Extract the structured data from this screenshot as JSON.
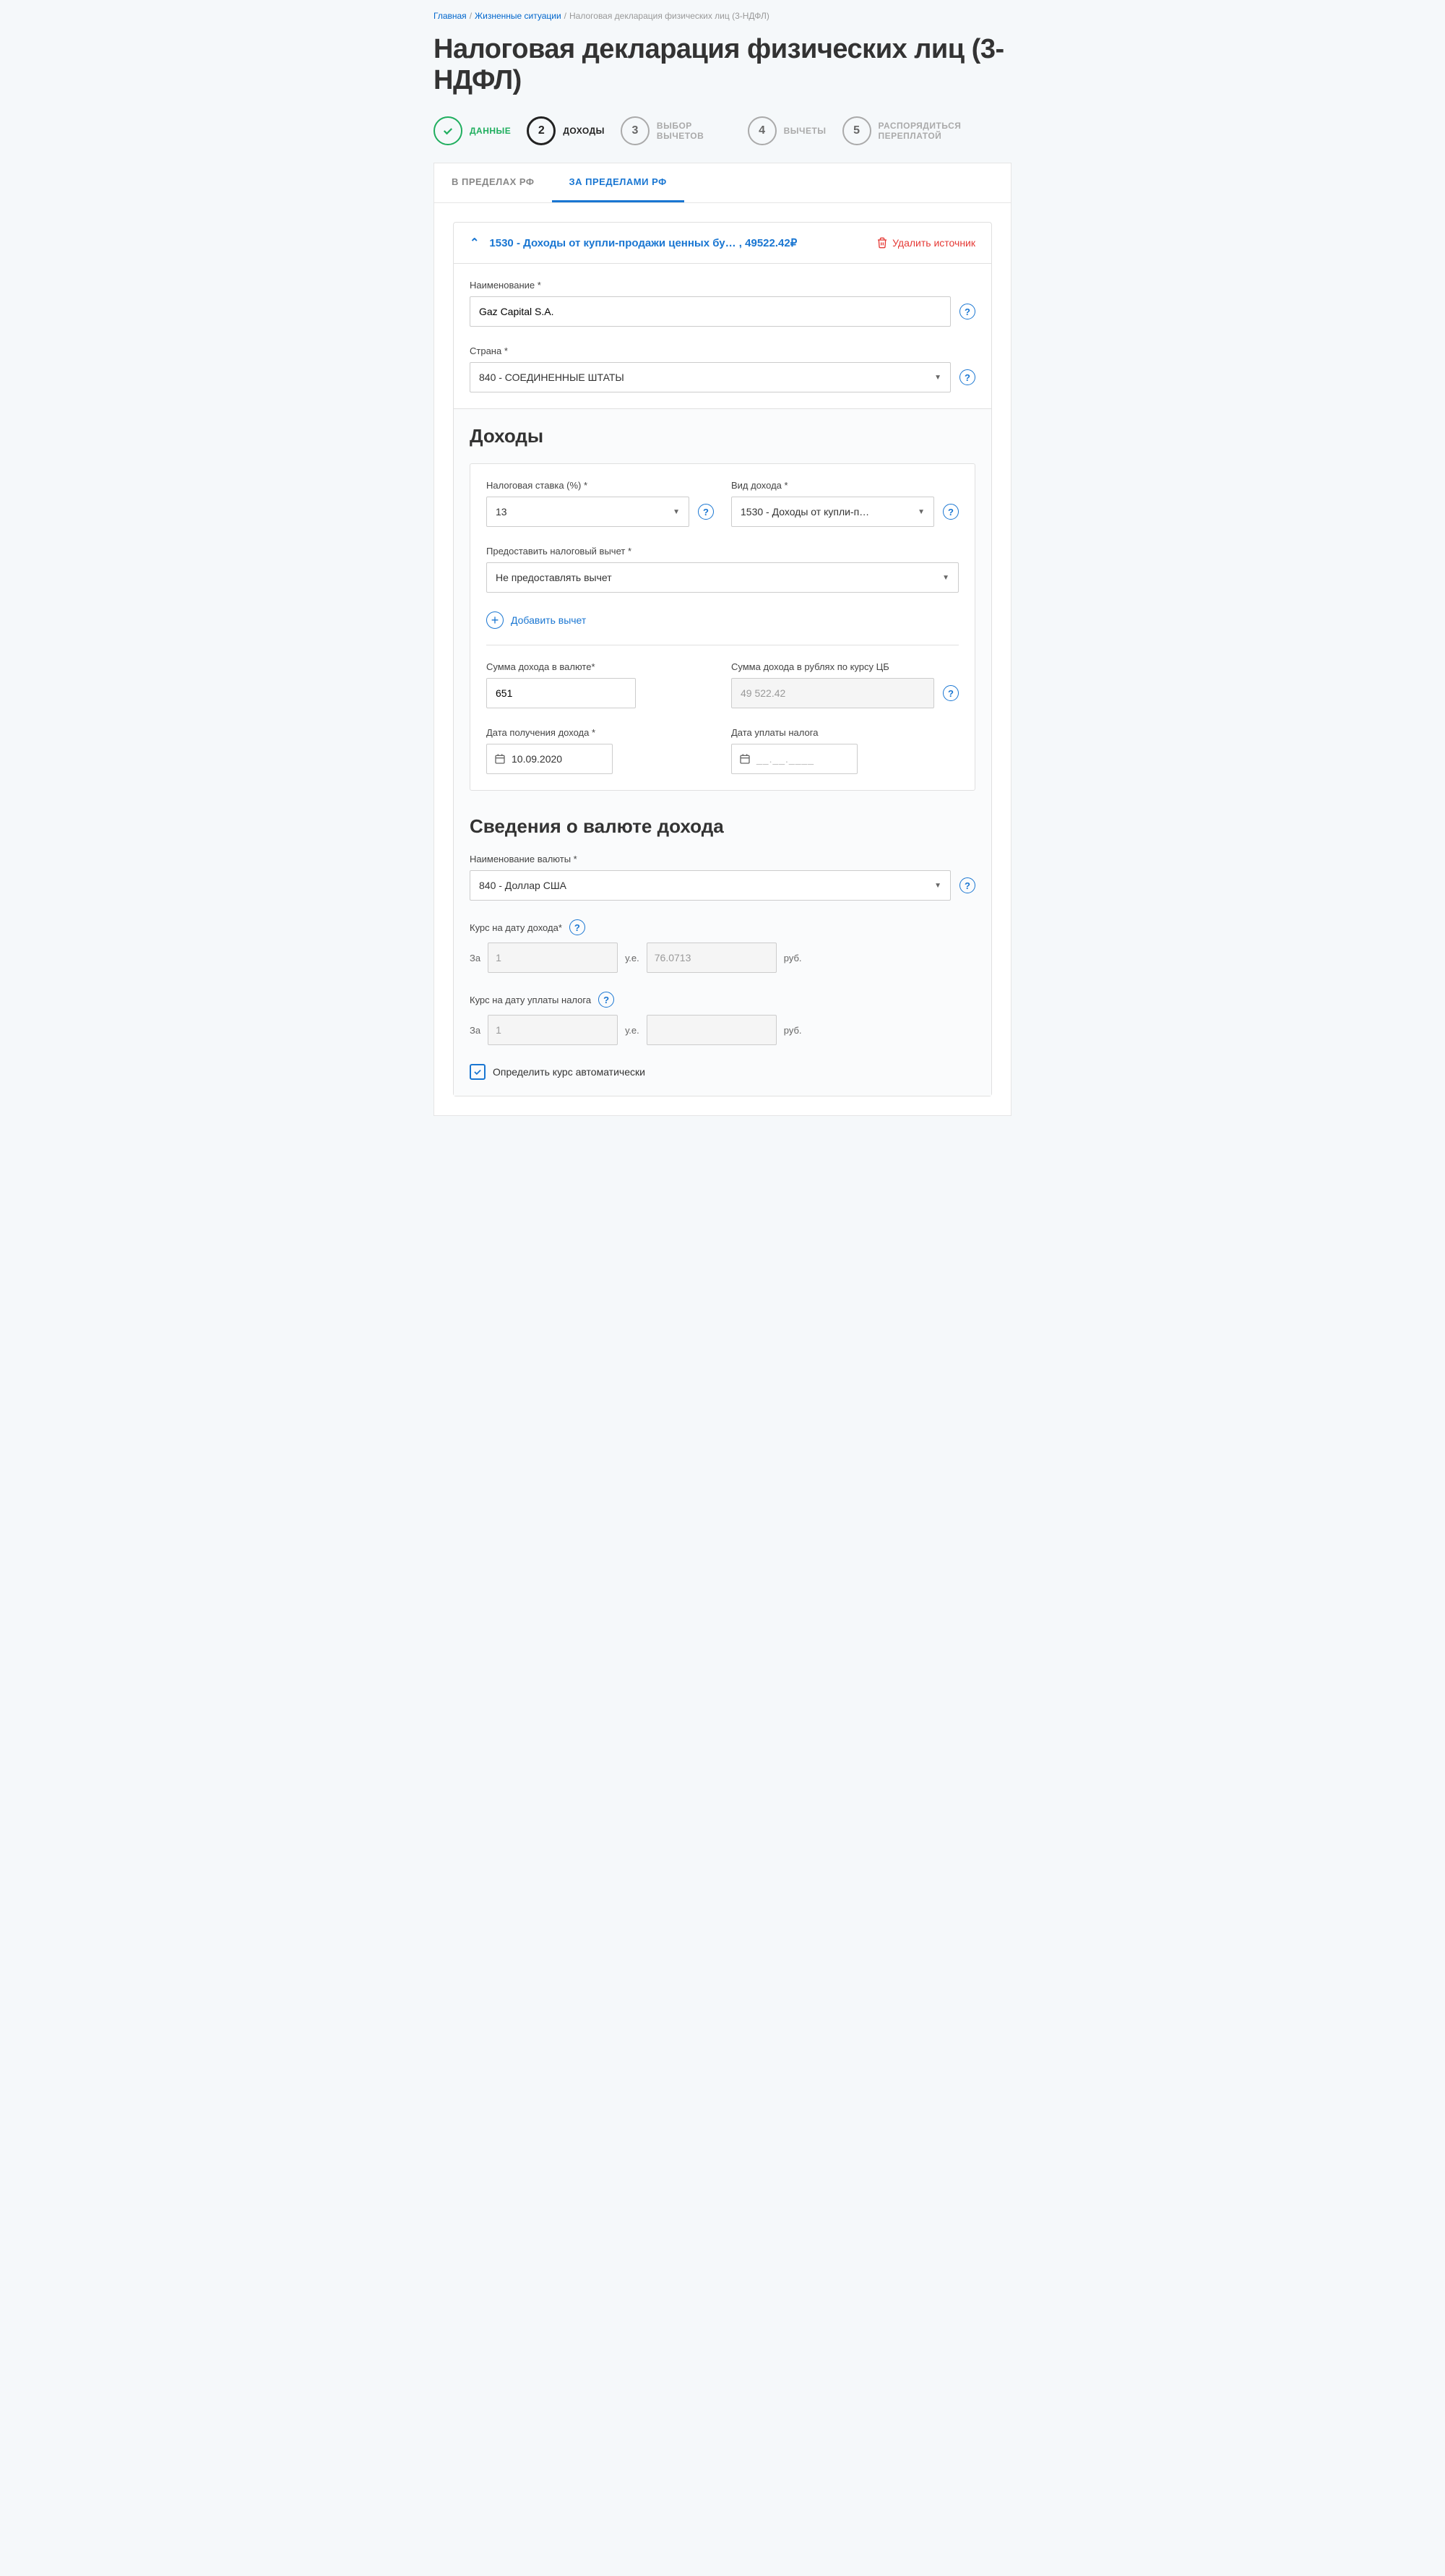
{
  "breadcrumb": {
    "home": "Главная",
    "situations": "Жизненные ситуации",
    "current": "Налоговая декларация физических лиц (3-НДФЛ)"
  },
  "page_title": "Налоговая декларация физических лиц (3-НДФЛ)",
  "steps": {
    "s1": "ДАННЫЕ",
    "s2": "ДОХОДЫ",
    "s3": "ВЫБОР ВЫЧЕТОВ",
    "s4": "ВЫЧЕТЫ",
    "s5": "РАСПОРЯДИТЬСЯ ПЕРЕПЛАТОЙ",
    "n2": "2",
    "n3": "3",
    "n4": "4",
    "n5": "5"
  },
  "tabs": {
    "inside": "В ПРЕДЕЛАХ РФ",
    "outside": "ЗА ПРЕДЕЛАМИ РФ"
  },
  "source": {
    "title": "1530 - Доходы от купли-продажи ценных бу…  , 49522.42₽",
    "delete": "Удалить источник",
    "name_label": "Наименование *",
    "name_value": "Gaz Capital S.A.",
    "country_label": "Страна *",
    "country_value": "840 - СОЕДИНЕННЫЕ ШТАТЫ"
  },
  "income": {
    "section_title": "Доходы",
    "rate_label": "Налоговая ставка (%) *",
    "rate_value": "13",
    "type_label": "Вид дохода *",
    "type_value": "1530 - Доходы от купли-прод…",
    "deduction_label": "Предоставить налоговый вычет *",
    "deduction_value": "Не предоставлять вычет",
    "add_deduction": "Добавить вычет",
    "amount_fx_label": "Сумма дохода в валюте*",
    "amount_fx_value": "651",
    "amount_rub_label": "Сумма дохода в рублях по курсу ЦБ",
    "amount_rub_value": "49 522.42",
    "date_income_label": "Дата получения дохода *",
    "date_income_value": "10.09.2020",
    "date_tax_label": "Дата уплаты налога",
    "date_tax_placeholder": "__.__.____"
  },
  "currency": {
    "section_title": "Сведения о валюте дохода",
    "name_label": "Наименование валюты *",
    "name_value": "840 - Доллар США",
    "rate_income_label": "Курс на дату дохода*",
    "rate_tax_label": "Курс на дату уплаты налога",
    "prefix": "За",
    "unit_fx": "у.е.",
    "unit_rub": "руб.",
    "per_unit": "1",
    "rate_value": "76.0713",
    "auto_checkbox": "Определить курс автоматически"
  }
}
